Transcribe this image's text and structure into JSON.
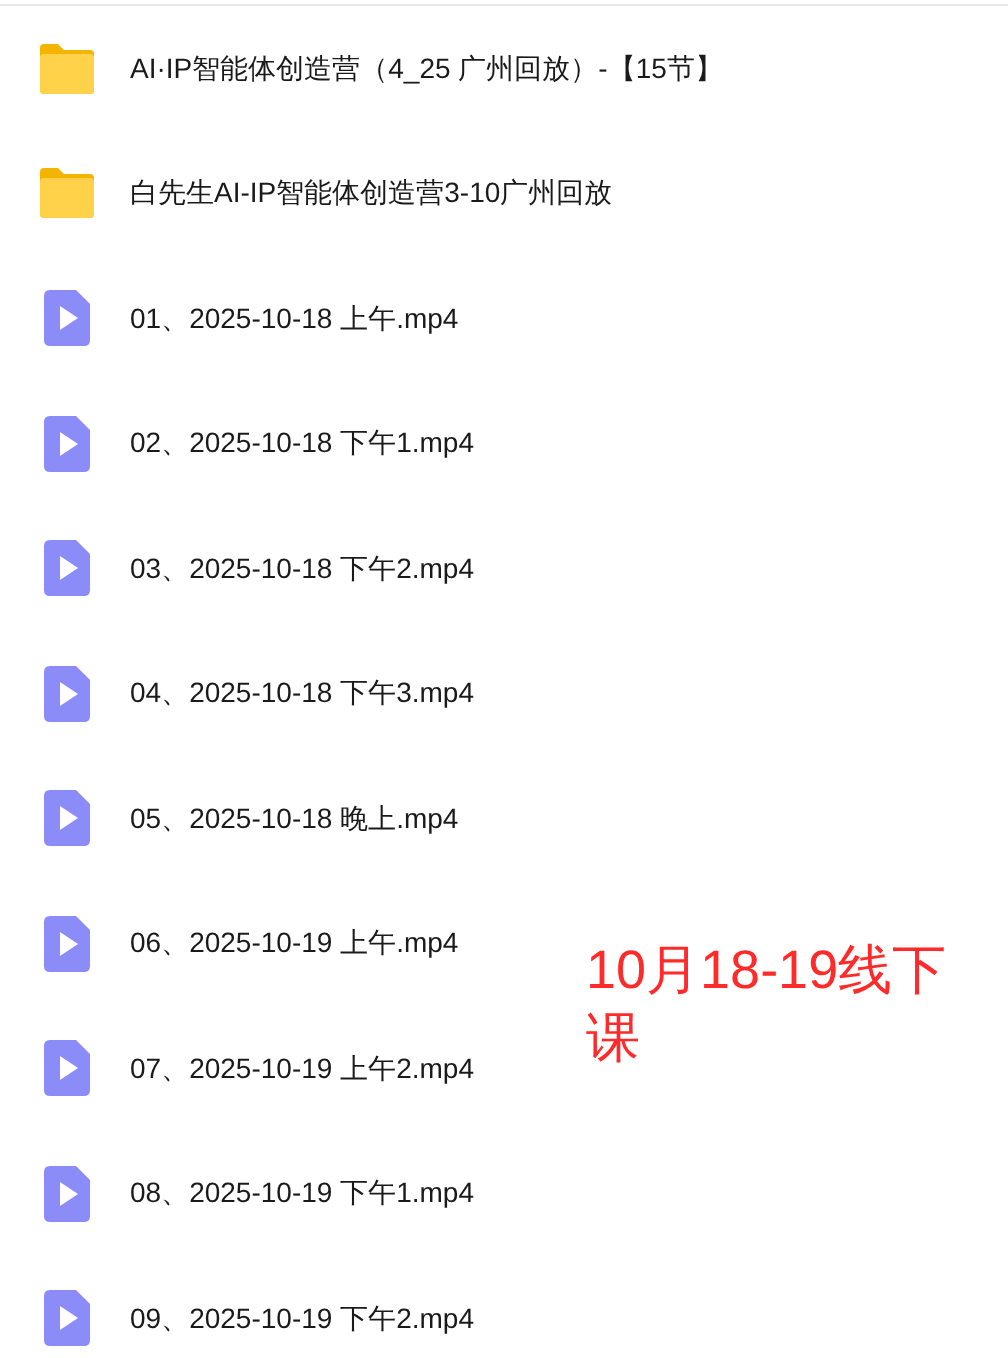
{
  "files": [
    {
      "kind": "folder",
      "name": "AI·IP智能体创造营（4_25 广州回放）-【15节】"
    },
    {
      "kind": "folder",
      "name": "白先生AI-IP智能体创造营3-10广州回放"
    },
    {
      "kind": "video",
      "name": "01、2025-10-18 上午.mp4"
    },
    {
      "kind": "video",
      "name": "02、2025-10-18 下午1.mp4"
    },
    {
      "kind": "video",
      "name": "03、2025-10-18 下午2.mp4"
    },
    {
      "kind": "video",
      "name": "04、2025-10-18 下午3.mp4"
    },
    {
      "kind": "video",
      "name": "05、2025-10-18 晚上.mp4"
    },
    {
      "kind": "video",
      "name": "06、2025-10-19 上午.mp4"
    },
    {
      "kind": "video",
      "name": "07、2025-10-19 上午2.mp4"
    },
    {
      "kind": "video",
      "name": "08、2025-10-19 下午1.mp4"
    },
    {
      "kind": "video",
      "name": "09、2025-10-19 下午2.mp4"
    }
  ],
  "annotation": "10月18-19线下课"
}
